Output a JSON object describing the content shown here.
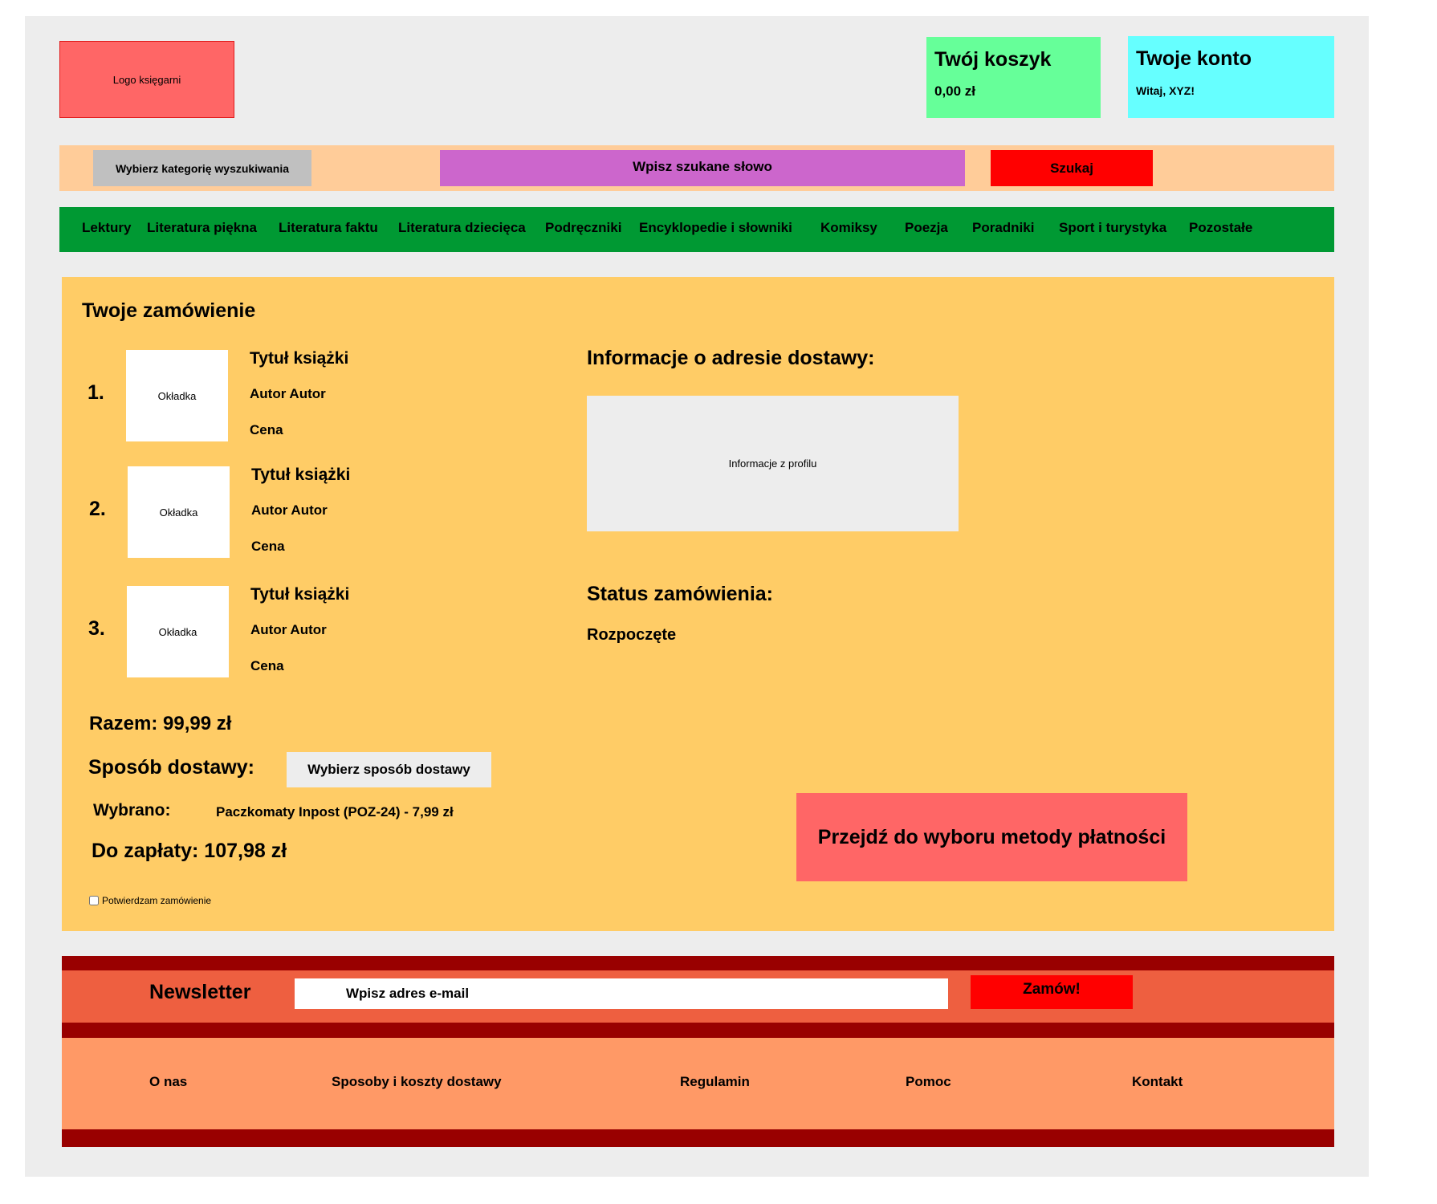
{
  "header": {
    "logo_text": "Logo księgarni",
    "cart": {
      "title": "Twój koszyk",
      "amount": "0,00 zł"
    },
    "account": {
      "title": "Twoje konto",
      "greeting": "Witaj, XYZ!"
    }
  },
  "search": {
    "category_label": "Wybierz kategorię wyszukiwania",
    "input_text": "Wpisz szukane słowo",
    "button_label": "Szukaj"
  },
  "nav": {
    "items": [
      "Lektury",
      "Literatura piękna",
      "Literatura faktu",
      "Literatura dziecięca",
      "Podręczniki",
      "Encyklopedie i słowniki",
      "Komiksy",
      "Poezja",
      "Poradniki",
      "Sport i turystyka",
      "Pozostałe"
    ]
  },
  "order": {
    "title": "Twoje zamówienie",
    "items": [
      {
        "number": "1.",
        "cover": "Okładka",
        "title": "Tytuł książki",
        "author": "Autor Autor",
        "price": "Cena"
      },
      {
        "number": "2.",
        "cover": "Okładka",
        "title": "Tytuł książki",
        "author": "Autor Autor",
        "price": "Cena"
      },
      {
        "number": "3.",
        "cover": "Okładka",
        "title": "Tytuł książki",
        "author": "Autor Autor",
        "price": "Cena"
      }
    ],
    "address_title": "Informacje o adresie dostawy:",
    "address_box": "Informacje z profilu",
    "status_title": "Status zamówienia:",
    "status_value": "Rozpoczęte",
    "total": "Razem: 99,99 zł",
    "delivery_label": "Sposób dostawy:",
    "delivery_button": "Wybierz sposób dostawy",
    "chosen_label": "Wybrano:",
    "chosen_value": "Paczkomaty Inpost (POZ-24) - 7,99 zł",
    "to_pay": "Do zapłaty: 107,98 zł",
    "confirm_label": "Potwierdzam zamówienie",
    "confirm_checked": false,
    "pay_button": "Przejdź do wyboru metody płatności"
  },
  "newsletter": {
    "title": "Newsletter",
    "input_text": "Wpisz adres e-mail",
    "button_label": "Zamów!"
  },
  "footer": {
    "links": [
      "O nas",
      "Sposoby i koszty dostawy",
      "Regulamin",
      "Pomoc",
      "Kontakt"
    ]
  },
  "colors": {
    "page_bg": "#ededed",
    "logo": "#ff6666",
    "cart": "#66ff99",
    "account": "#66ffff",
    "search_bar": "#ffcc99",
    "search_input": "#cc66cc",
    "search_button": "#ff0000",
    "nav": "#009933",
    "main": "#ffcc66",
    "pay_button": "#ff6666",
    "newsletter": "#ee5f40",
    "footer_band": "#990000",
    "footer_links": "#ff9966"
  }
}
